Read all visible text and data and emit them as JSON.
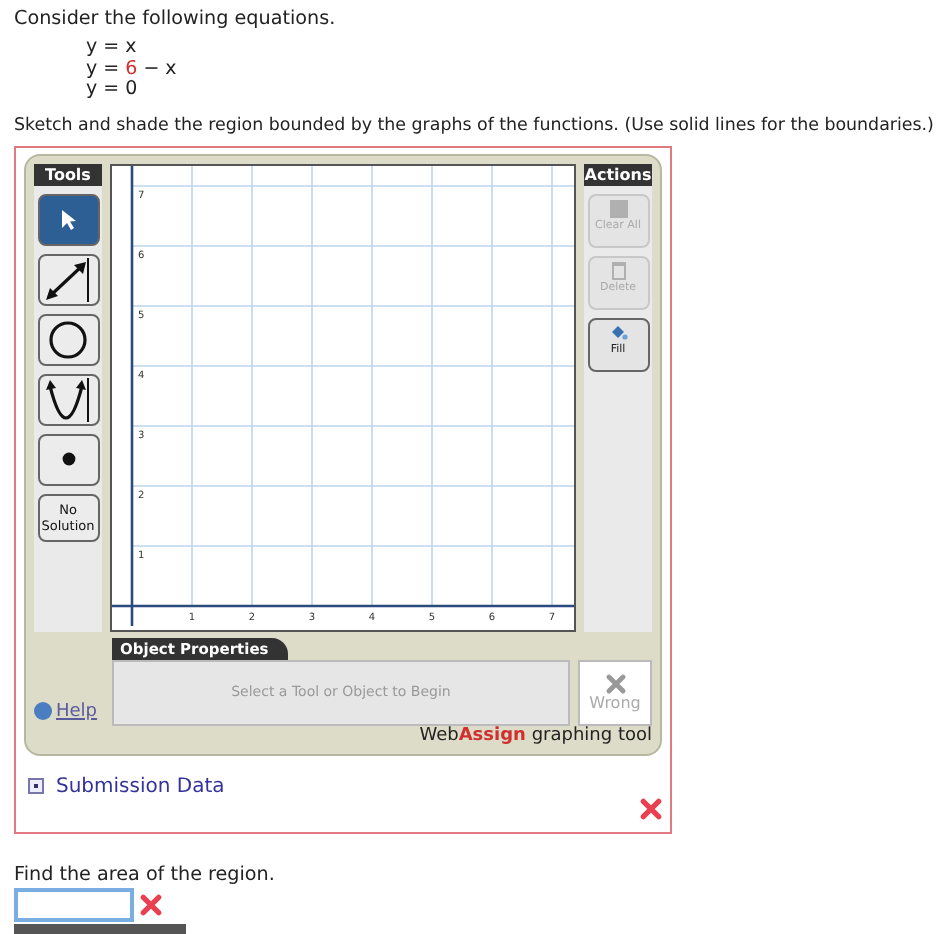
{
  "intro": "Consider the following equations.",
  "equations": [
    {
      "parts": [
        {
          "text": "y = x",
          "highlight": false
        }
      ]
    },
    {
      "parts": [
        {
          "text": "y = ",
          "highlight": false
        },
        {
          "text": "6",
          "highlight": true
        },
        {
          "text": " − x",
          "highlight": false
        }
      ]
    },
    {
      "parts": [
        {
          "text": "y = 0",
          "highlight": false
        }
      ]
    }
  ],
  "instruction": "Sketch and shade the region bounded by the graphs of the functions. (Use solid lines for the boundaries.)",
  "graphing_tool": {
    "tools_title": "Tools",
    "tools": [
      {
        "kind": "select",
        "selected": true
      },
      {
        "kind": "line",
        "selected": false
      },
      {
        "kind": "circle",
        "selected": false
      },
      {
        "kind": "parabola",
        "selected": false
      },
      {
        "kind": "point",
        "selected": false
      },
      {
        "kind": "text",
        "label": "No Solution",
        "selected": false
      }
    ],
    "graph": {
      "x_ticks": [
        "1",
        "2",
        "3",
        "4",
        "5",
        "6",
        "7"
      ],
      "y_ticks": [
        "7",
        "6",
        "5",
        "4",
        "3",
        "2",
        "1"
      ]
    },
    "actions_title": "Actions",
    "actions": [
      {
        "kind": "clear",
        "label": "Clear All",
        "disabled": true
      },
      {
        "kind": "delete",
        "label": "Delete",
        "disabled": true
      },
      {
        "kind": "fill",
        "label": "Fill",
        "disabled": false
      }
    ],
    "properties_title": "Object Properties",
    "properties_hint": "Select a Tool or Object to Begin",
    "result": "Wrong",
    "help": "Help",
    "brand_plain": "Web",
    "brand_bold": "Assign",
    "brand_tail": "graphing tool"
  },
  "submission_data": "Submission Data",
  "submission_correct": false,
  "question": "Find the area of the region.",
  "answer": {
    "correct": false
  }
}
